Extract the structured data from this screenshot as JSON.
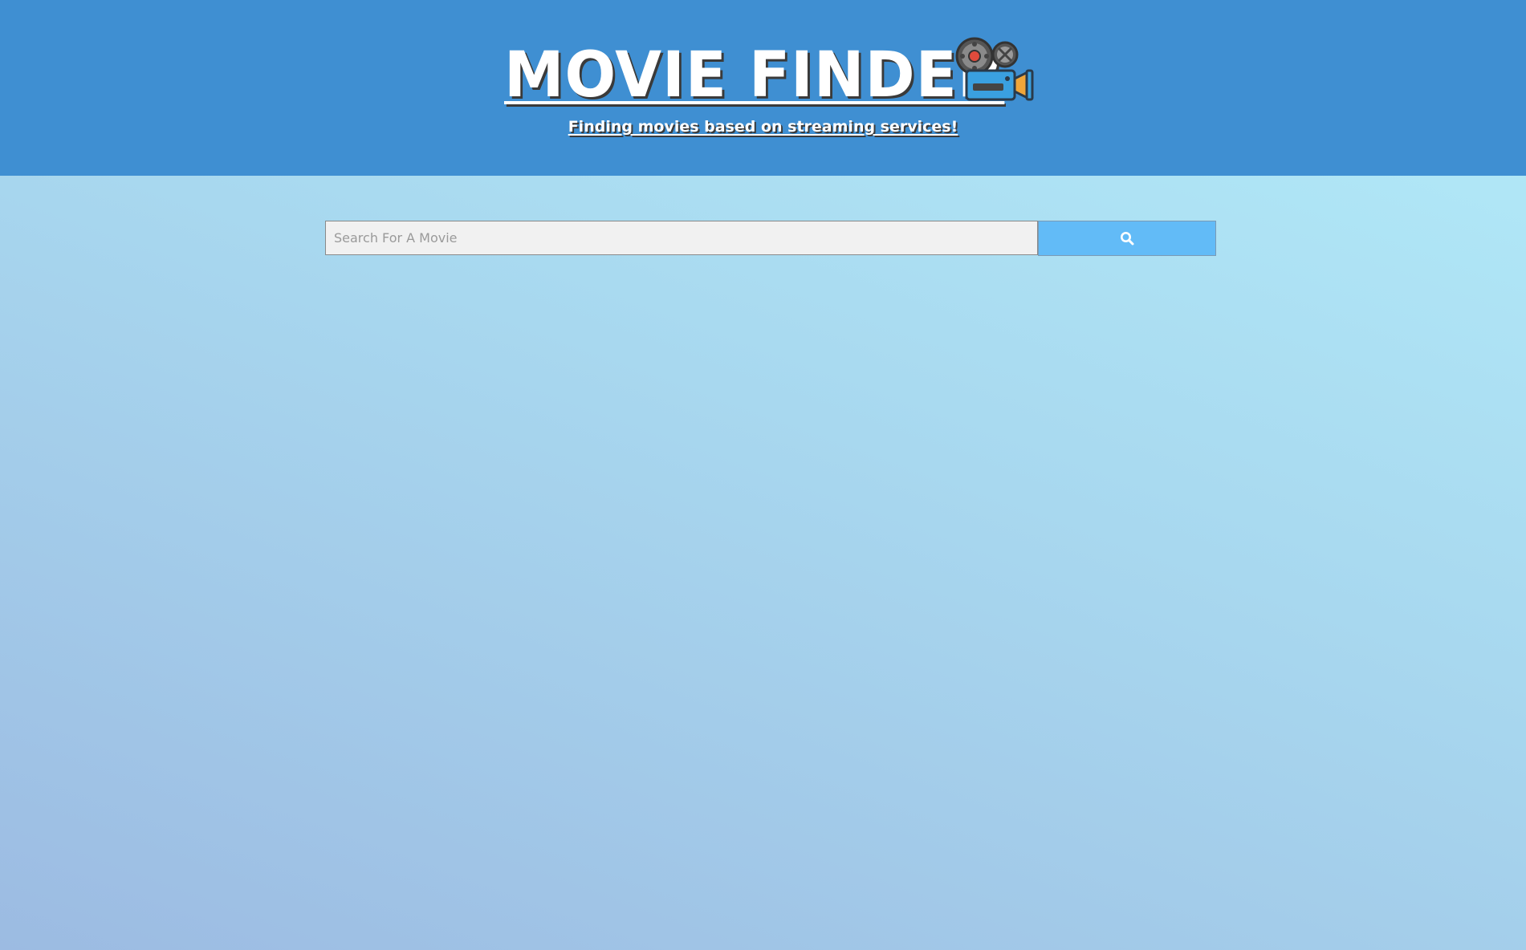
{
  "header": {
    "title": "MOVIE FINDER",
    "subtitle": "Finding movies based on streaming services!",
    "logo_icon": "movie-camera-icon",
    "background_color": "#3f8fd2"
  },
  "search": {
    "placeholder": "Search For A Movie",
    "value": "",
    "button_icon": "search-icon",
    "button_color": "#62bbf7"
  }
}
